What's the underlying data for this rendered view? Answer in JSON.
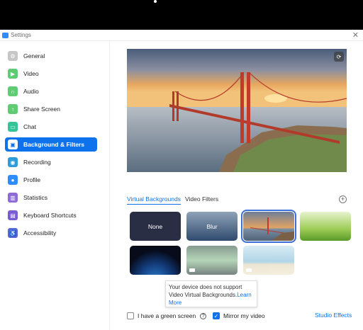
{
  "window": {
    "title": "Settings"
  },
  "sidebar": {
    "items": [
      {
        "label": "General",
        "icon": "gear-icon",
        "color": "#c7c7c7"
      },
      {
        "label": "Video",
        "icon": "video-icon",
        "color": "#5fcb72"
      },
      {
        "label": "Audio",
        "icon": "headphones-icon",
        "color": "#5fcb72"
      },
      {
        "label": "Share Screen",
        "icon": "share-screen-icon",
        "color": "#5fcb72"
      },
      {
        "label": "Chat",
        "icon": "chat-icon",
        "color": "#35c49a"
      },
      {
        "label": "Background & Filters",
        "icon": "background-icon",
        "color": "#0e72ed",
        "active": true
      },
      {
        "label": "Recording",
        "icon": "record-icon",
        "color": "#2d9cdb"
      },
      {
        "label": "Profile",
        "icon": "profile-icon",
        "color": "#2d8cff"
      },
      {
        "label": "Statistics",
        "icon": "statistics-icon",
        "color": "#8e6bd6"
      },
      {
        "label": "Keyboard Shortcuts",
        "icon": "keyboard-icon",
        "color": "#7a5bd1"
      },
      {
        "label": "Accessibility",
        "icon": "accessibility-icon",
        "color": "#5a67d8"
      }
    ]
  },
  "tabs": {
    "virtual": "Virtual Backgrounds",
    "filters": "Video Filters"
  },
  "thumbnails": [
    {
      "label": "None"
    },
    {
      "label": "Blur"
    },
    {
      "label": ""
    },
    {
      "label": ""
    },
    {
      "label": ""
    },
    {
      "label": ""
    },
    {
      "label": ""
    }
  ],
  "tooltip": {
    "text": "Your device does not support Video Virtual Backgrounds.",
    "link": "Learn More"
  },
  "bottom": {
    "green_screen": "I have a green screen",
    "mirror": "Mirror my video",
    "studio": "Studio Effects"
  },
  "colors": {
    "accent": "#0e72ed"
  }
}
